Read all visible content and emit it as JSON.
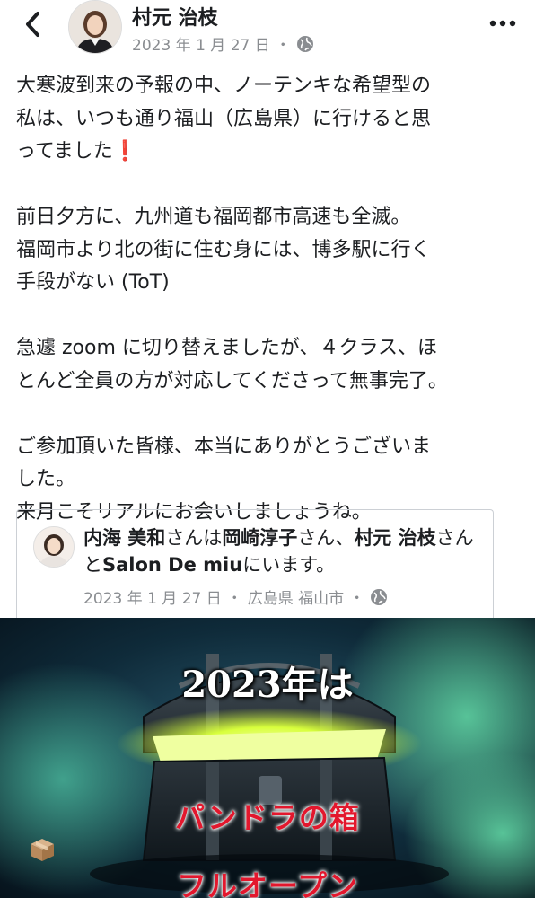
{
  "header": {
    "author": "村元 治枝",
    "date": "2023 年 1 月 27 日",
    "separator": "・",
    "back_icon": "chevron-left-icon",
    "more_icon": "more-horizontal-icon",
    "privacy_icon": "globe-icon"
  },
  "post": {
    "paragraphs": [
      "大寒波到来の予報の中、ノーテンキな希望型の\n私は、いつも通り福山（広島県）に行けると思\nってました",
      "前日夕方に、九州道も福岡都市高速も全滅。\n福岡市より北の街に住む身には、博多駅に行く\n手段がない (ToT)",
      "急遽 zoom に切り替えましたが、４クラス、ほ\nとんど全員の方が対応してくださって無事完了。",
      "ご参加頂いた皆様、本当にありがとうございま\nした。\n来月こそリアルにお会いしましょうね。"
    ],
    "exclamation": "❗"
  },
  "checkin": {
    "person": "内海 美和",
    "particle1": "さんは",
    "friend1": "岡崎淳子",
    "particle2": "さん、",
    "friend2": "村元 治枝",
    "particle3": "さんと",
    "place": "Salon De miu",
    "particle4": "にいます。",
    "date": "2023 年 1 月 27 日",
    "separator": "・",
    "location": "広島県 福山市",
    "separator2": "・"
  },
  "promo": {
    "title": "2023年は",
    "subtitle_before": "パンドラの箱",
    "subtitle_after": "フルオープン",
    "icon": "package-box-icon"
  },
  "colors": {
    "text": "#1c1e21",
    "meta": "#8a8d91",
    "exclamation": "#d7263d",
    "promo_red": "#e3172d",
    "glow": "#d8ff3c"
  }
}
